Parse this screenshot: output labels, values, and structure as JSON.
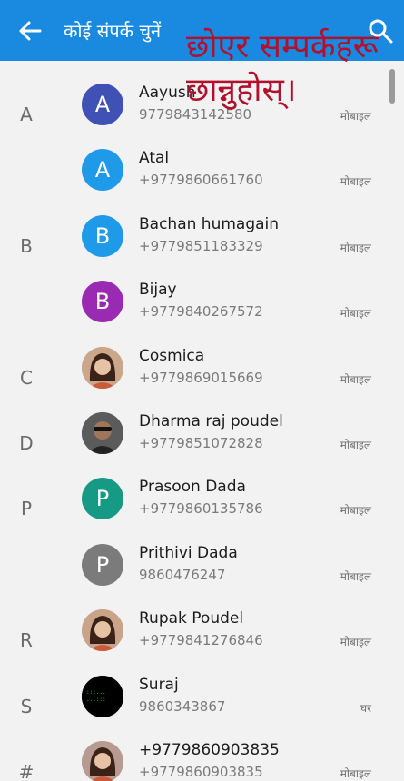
{
  "header": {
    "title": "कोई संपर्क चुनें",
    "overlay_text": "छोएर सम्पर्कहरू\nछान्नुहोस्।"
  },
  "contacts": [
    {
      "section": "A",
      "name": "Aayush",
      "phone": "9779843142580",
      "type": "मोबाइल",
      "initial": "A",
      "color": "#3f51b5",
      "photo": ""
    },
    {
      "section": "",
      "name": "Atal",
      "phone": "+9779860661760",
      "type": "मोबाइल",
      "initial": "A",
      "color": "#1e9ae8",
      "photo": ""
    },
    {
      "section": "B",
      "name": "Bachan humagain",
      "phone": "+9779851183329",
      "type": "मोबाइल",
      "initial": "B",
      "color": "#1e9ae8",
      "photo": ""
    },
    {
      "section": "",
      "name": "Bijay",
      "phone": "+9779840267572",
      "type": "मोबाइल",
      "initial": "B",
      "color": "#9b2ab3",
      "photo": ""
    },
    {
      "section": "C",
      "name": "Cosmica",
      "phone": "+9779869015669",
      "type": "मोबाइल",
      "initial": "",
      "color": "#caa68a",
      "photo": "woman"
    },
    {
      "section": "D",
      "name": "Dharma raj poudel",
      "phone": "+9779851072828",
      "type": "मोबाइल",
      "initial": "",
      "color": "#5d5d5d",
      "photo": "man"
    },
    {
      "section": "P",
      "name": "Prasoon Dada",
      "phone": "+9779860135786",
      "type": "मोबाइल",
      "initial": "P",
      "color": "#179a85",
      "photo": ""
    },
    {
      "section": "",
      "name": "Prithivi Dada",
      "phone": "9860476247",
      "type": "मोबाइल",
      "initial": "P",
      "color": "#7b7b7b",
      "photo": ""
    },
    {
      "section": "R",
      "name": "Rupak Poudel",
      "phone": "+9779841276846",
      "type": "मोबाइल",
      "initial": "",
      "color": "#c9a489",
      "photo": "woman2"
    },
    {
      "section": "S",
      "name": "Suraj",
      "phone": "9860343867",
      "type": "घर",
      "initial": "",
      "color": "#000000",
      "photo": "dark"
    },
    {
      "section": "#",
      "name": "+9779860903835",
      "phone": "+9779860903835",
      "type": "मोबाइल",
      "initial": "",
      "color": "#b89a90",
      "photo": "woman3"
    }
  ]
}
